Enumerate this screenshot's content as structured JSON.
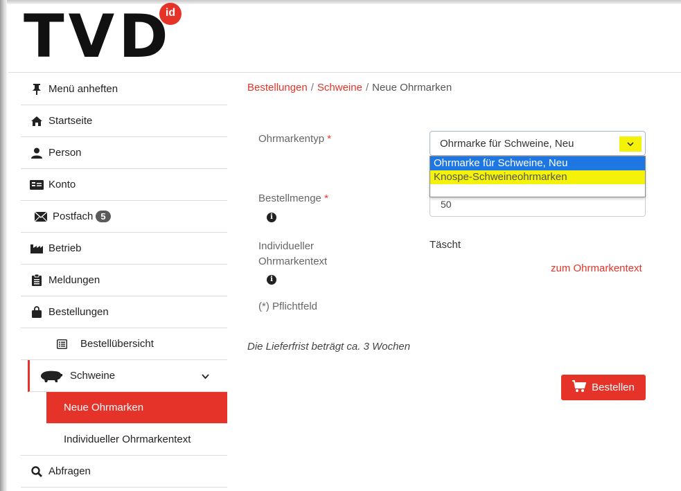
{
  "logo": {
    "text": "TVD",
    "badge": "id"
  },
  "sidebar": {
    "items": [
      {
        "label": "Menü anheften",
        "icon": "pin-icon"
      },
      {
        "label": "Startseite",
        "icon": "home-icon"
      },
      {
        "label": "Person",
        "icon": "person-icon"
      },
      {
        "label": "Konto",
        "icon": "account-card-icon"
      },
      {
        "label": "Postfach",
        "icon": "envelope-icon",
        "badge": "5"
      },
      {
        "label": "Betrieb",
        "icon": "factory-icon"
      },
      {
        "label": "Meldungen",
        "icon": "clipboard-icon"
      },
      {
        "label": "Bestellungen",
        "icon": "shopping-bag-icon"
      },
      {
        "label": "Bestellübersicht",
        "icon": "list-icon"
      },
      {
        "label": "Schweine",
        "icon": "pig-icon"
      },
      {
        "label": "Neue Ohrmarken"
      },
      {
        "label": "Individueller Ohrmarkentext"
      },
      {
        "label": "Abfragen",
        "icon": "search-icon"
      }
    ]
  },
  "breadcrumb": {
    "item1": "Bestellungen",
    "item2": "Schweine",
    "current": "Neue Ohrmarken",
    "separator": "/"
  },
  "form": {
    "type_label": "Ohrmarkentyp",
    "required_mark": "*",
    "type_value": "Ohrmarke für Schweine, Neu",
    "type_options": [
      "Ohrmarke für Schweine, Neu",
      "Knospe-Schweineohrmarken"
    ],
    "quantity_label": "Bestellmenge",
    "quantity_value": "50",
    "text_label_line1": "Individueller",
    "text_label_line2": "Ohrmarkentext",
    "text_value": "Täscht",
    "text_link": "zum Ohrmarkentext",
    "required_note": "(*) Pflichtfeld",
    "delivery_note": "Die Lieferfrist beträgt ca. 3 Wochen",
    "order_button": "Bestellen"
  },
  "colors": {
    "accent": "#e63329",
    "highlight": "#f5f20a",
    "selection": "#1e76e3"
  }
}
